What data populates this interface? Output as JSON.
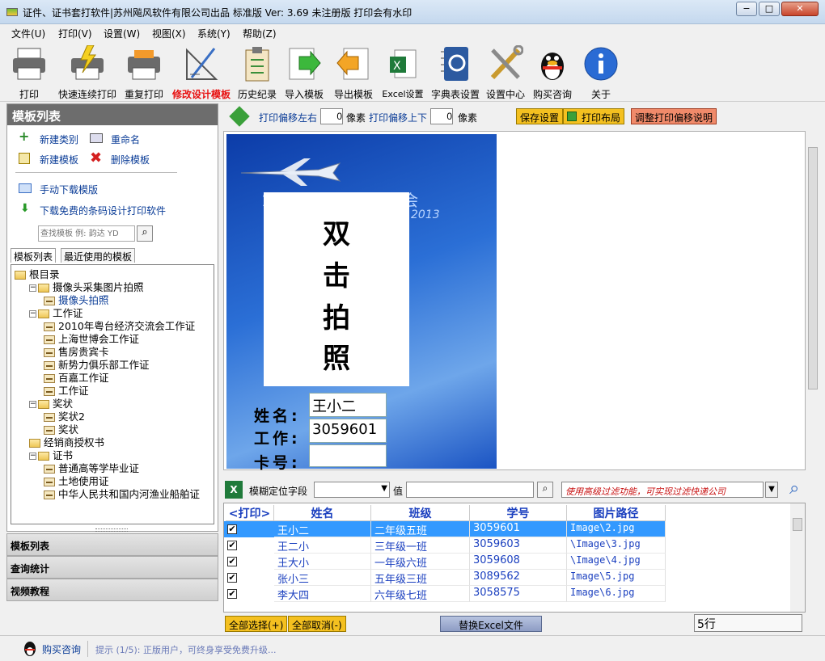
{
  "window": {
    "title": "证件、证书套打软件|苏州飚风软件有限公司出品 标准版  Ver: 3.69  未注册版 打印会有水印",
    "min": "−",
    "max": "□",
    "close": "✕"
  },
  "menu": [
    "文件(U)",
    "打印(V)",
    "设置(W)",
    "视图(X)",
    "系统(Y)",
    "帮助(Z)"
  ],
  "toolbar": [
    {
      "label": "打印",
      "icon": "printer-icon"
    },
    {
      "label": "快速连续打印",
      "icon": "fast-print-icon"
    },
    {
      "label": "重复打印",
      "icon": "reprint-icon"
    },
    {
      "label": "修改设计模板",
      "icon": "design-icon",
      "active": true
    },
    {
      "label": "历史纪录",
      "icon": "history-icon"
    },
    {
      "label": "导入模板",
      "icon": "import-icon"
    },
    {
      "label": "导出模板",
      "icon": "export-icon"
    },
    {
      "label": "Excel设置",
      "icon": "excel-icon"
    },
    {
      "label": "字典表设置",
      "icon": "dictionary-icon"
    },
    {
      "label": "设置中心",
      "icon": "tools-icon"
    },
    {
      "label": "购买咨询",
      "icon": "qq-icon"
    },
    {
      "label": "关于",
      "icon": "info-icon"
    }
  ],
  "left": {
    "header": "模板列表",
    "new_category": "新建类别",
    "rename": "重命名",
    "new_template": "新建模板",
    "delete_template": "删除模板",
    "manual_download": "手动下载模版",
    "free_download": "下载免费的条码设计打印软件",
    "search_placeholder": "查找模板 例: 韵达 YD",
    "tab1": "模板列表",
    "tab2": "最近使用的模板",
    "tree": [
      {
        "label": "根目录",
        "level": 0,
        "type": "folder",
        "exp": ""
      },
      {
        "label": "摄像头采集图片拍照",
        "level": 1,
        "type": "folder",
        "exp": "−"
      },
      {
        "label": "摄像头拍照",
        "level": 2,
        "type": "leaf",
        "selected": true
      },
      {
        "label": "工作证",
        "level": 1,
        "type": "folder",
        "exp": "−"
      },
      {
        "label": "2010年粤台经济交流会工作证",
        "level": 2,
        "type": "leaf"
      },
      {
        "label": "上海世博会工作证",
        "level": 2,
        "type": "leaf"
      },
      {
        "label": "售房贵宾卡",
        "level": 2,
        "type": "leaf"
      },
      {
        "label": "新势力俱乐部工作证",
        "level": 2,
        "type": "leaf"
      },
      {
        "label": "百嘉工作证",
        "level": 2,
        "type": "leaf"
      },
      {
        "label": "工作证",
        "level": 2,
        "type": "leaf"
      },
      {
        "label": "奖状",
        "level": 1,
        "type": "folder",
        "exp": "−"
      },
      {
        "label": "奖状2",
        "level": 2,
        "type": "leaf"
      },
      {
        "label": "奖状",
        "level": 2,
        "type": "leaf"
      },
      {
        "label": "经销商授权书",
        "level": 1,
        "type": "folder",
        "exp": ""
      },
      {
        "label": "证书",
        "level": 1,
        "type": "folder",
        "exp": "−"
      },
      {
        "label": "普通高等学毕业证",
        "level": 2,
        "type": "leaf"
      },
      {
        "label": "土地使用证",
        "level": 2,
        "type": "leaf"
      },
      {
        "label": "中华人民共和国内河渔业船舶证",
        "level": 2,
        "type": "leaf"
      }
    ],
    "accordion": [
      "模板列表",
      "查询统计",
      "视频教程"
    ]
  },
  "editbar": {
    "offset_lr": "打印偏移左右",
    "lr_value": "0",
    "px1": "像素",
    "offset_ud": "打印偏移上下",
    "ud_value": "0",
    "px2": "像素",
    "save": "保存设置",
    "layout": "打印布局",
    "adjust": "调整打印偏移说明"
  },
  "card": {
    "banner": "2010 上海世博会",
    "banner2": "2013",
    "photo_text": [
      "双",
      "击",
      "拍",
      "照"
    ],
    "name_label": "姓名:",
    "job_label": "工作:",
    "card_label": "卡号:",
    "name_value": "王小二",
    "job_value": "3059601",
    "card_value": ""
  },
  "filter": {
    "label": "模糊定位字段",
    "value_label": "值",
    "hint": "使用高级过滤功能，可实现过滤快递公司"
  },
  "grid": {
    "columns": [
      "<打印>",
      "姓名",
      "班级",
      "学号",
      "图片路径"
    ],
    "rows": [
      {
        "checked": true,
        "name": "王小二",
        "class": "二年级五班",
        "id": "3059601",
        "path": "Image\\2.jpg",
        "selected": true
      },
      {
        "checked": true,
        "name": "王二小",
        "class": "三年级一班",
        "id": "3059603",
        "path": "\\Image\\3.jpg"
      },
      {
        "checked": true,
        "name": "王大小",
        "class": "一年级六班",
        "id": "3059608",
        "path": "\\Image\\4.jpg"
      },
      {
        "checked": true,
        "name": "张小三",
        "class": "五年级三班",
        "id": "3089562",
        "path": "Image\\5.jpg"
      },
      {
        "checked": true,
        "name": "李大四",
        "class": "六年级七班",
        "id": "3058575",
        "path": "Image\\6.jpg"
      }
    ]
  },
  "bottom": {
    "select_all": "全部选择(+)",
    "deselect_all": "全部取消(-)",
    "replace_excel": "替换Excel文件",
    "row_count": "5行"
  },
  "status": {
    "buy": "购买咨询",
    "tip": "提示 (1/5): 正版用户，可终身享受免费升级..."
  },
  "colors": {
    "accent_red": "#e81010",
    "link_blue": "#0a3c97",
    "selection": "#3399ff"
  }
}
